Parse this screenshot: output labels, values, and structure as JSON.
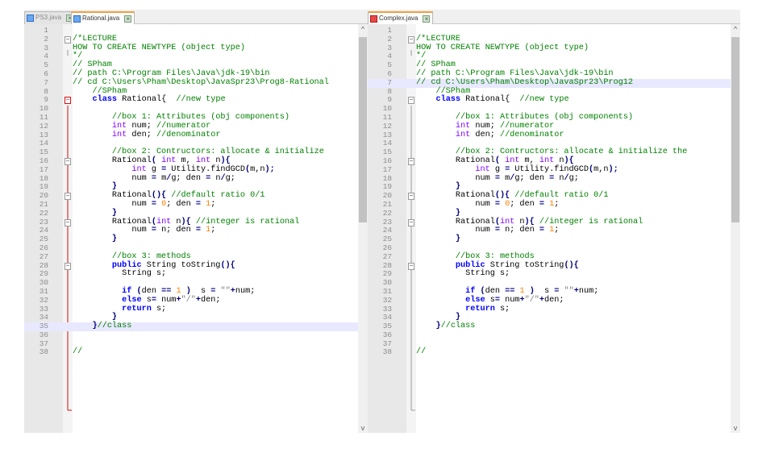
{
  "left_pane": {
    "tabs": [
      {
        "label": "PS3.java",
        "active": false
      },
      {
        "label": "Rational.java",
        "active": true
      }
    ],
    "lines": [
      [],
      [
        {
          "t": "/*LECTURE",
          "c": "cm"
        }
      ],
      [
        {
          "t": "HOW TO CREATE NEWTYPE (object type)",
          "c": "cm"
        }
      ],
      [
        {
          "t": "*/",
          "c": "cm"
        }
      ],
      [
        {
          "t": "// SPham",
          "c": "cm"
        }
      ],
      [
        {
          "t": "// path C:\\Program Files\\Java\\jdk-19\\bin",
          "c": "cm"
        }
      ],
      [
        {
          "t": "// cd C:\\Users\\Pham\\Desktop\\JavaSpr23\\Prog8-Rational",
          "c": "cm"
        }
      ],
      [
        {
          "t": "    //SPham",
          "c": "cm"
        }
      ],
      [
        {
          "t": "    "
        },
        {
          "t": "class",
          "c": "kw"
        },
        {
          "t": " Rational{  "
        },
        {
          "t": "//new type",
          "c": "cm"
        }
      ],
      [],
      [
        {
          "t": "        "
        },
        {
          "t": "//box 1: Attributes (obj components)",
          "c": "cm"
        }
      ],
      [
        {
          "t": "        "
        },
        {
          "t": "int",
          "c": "ty"
        },
        {
          "t": " num; "
        },
        {
          "t": "//numerator",
          "c": "cm"
        }
      ],
      [
        {
          "t": "        "
        },
        {
          "t": "int",
          "c": "ty"
        },
        {
          "t": " den; "
        },
        {
          "t": "//denominator",
          "c": "cm"
        }
      ],
      [],
      [
        {
          "t": "        "
        },
        {
          "t": "//box 2: Contructors: allocate & initialize",
          "c": "cm"
        }
      ],
      [
        {
          "t": "        Rational"
        },
        {
          "t": "(",
          "c": "op"
        },
        {
          "t": " "
        },
        {
          "t": "int",
          "c": "ty"
        },
        {
          "t": " m, "
        },
        {
          "t": "int",
          "c": "ty"
        },
        {
          "t": " n"
        },
        {
          "t": "){",
          "c": "op"
        }
      ],
      [
        {
          "t": "            "
        },
        {
          "t": "int",
          "c": "ty"
        },
        {
          "t": " g "
        },
        {
          "t": "=",
          "c": "op"
        },
        {
          "t": " Utility.findGCD"
        },
        {
          "t": "(",
          "c": "op"
        },
        {
          "t": "m,n"
        },
        {
          "t": ");",
          "c": "op"
        }
      ],
      [
        {
          "t": "            num "
        },
        {
          "t": "=",
          "c": "op"
        },
        {
          "t": " m"
        },
        {
          "t": "/",
          "c": "op"
        },
        {
          "t": "g; den "
        },
        {
          "t": "=",
          "c": "op"
        },
        {
          "t": " n"
        },
        {
          "t": "/",
          "c": "op"
        },
        {
          "t": "g;"
        }
      ],
      [
        {
          "t": "        "
        },
        {
          "t": "}",
          "c": "op"
        }
      ],
      [
        {
          "t": "        Rational"
        },
        {
          "t": "(){",
          "c": "op"
        },
        {
          "t": " "
        },
        {
          "t": "//default ratio 0/1",
          "c": "cm"
        }
      ],
      [
        {
          "t": "            num "
        },
        {
          "t": "=",
          "c": "op"
        },
        {
          "t": " "
        },
        {
          "t": "0",
          "c": "nm"
        },
        {
          "t": "; den "
        },
        {
          "t": "=",
          "c": "op"
        },
        {
          "t": " "
        },
        {
          "t": "1",
          "c": "nm"
        },
        {
          "t": ";"
        }
      ],
      [
        {
          "t": "        "
        },
        {
          "t": "}",
          "c": "op"
        }
      ],
      [
        {
          "t": "        Rational"
        },
        {
          "t": "(",
          "c": "op"
        },
        {
          "t": "int",
          "c": "ty"
        },
        {
          "t": " n"
        },
        {
          "t": "){",
          "c": "op"
        },
        {
          "t": " "
        },
        {
          "t": "//integer is rational",
          "c": "cm"
        }
      ],
      [
        {
          "t": "            num "
        },
        {
          "t": "=",
          "c": "op"
        },
        {
          "t": " n; den "
        },
        {
          "t": "=",
          "c": "op"
        },
        {
          "t": " "
        },
        {
          "t": "1",
          "c": "nm"
        },
        {
          "t": ";"
        }
      ],
      [
        {
          "t": "        "
        },
        {
          "t": "}",
          "c": "op"
        }
      ],
      [],
      [
        {
          "t": "        "
        },
        {
          "t": "//box 3: methods",
          "c": "cm"
        }
      ],
      [
        {
          "t": "        "
        },
        {
          "t": "public",
          "c": "kw"
        },
        {
          "t": " String toString"
        },
        {
          "t": "(){",
          "c": "op"
        }
      ],
      [
        {
          "t": "          String s;"
        }
      ],
      [],
      [
        {
          "t": "          "
        },
        {
          "t": "if",
          "c": "kw"
        },
        {
          "t": " "
        },
        {
          "t": "(",
          "c": "op"
        },
        {
          "t": "den "
        },
        {
          "t": "==",
          "c": "op"
        },
        {
          "t": " "
        },
        {
          "t": "1",
          "c": "nm"
        },
        {
          "t": " "
        },
        {
          "t": ")",
          "c": "op"
        },
        {
          "t": "  s "
        },
        {
          "t": "=",
          "c": "op"
        },
        {
          "t": " "
        },
        {
          "t": "\"\"",
          "c": "st"
        },
        {
          "t": "+",
          "c": "op"
        },
        {
          "t": "num;"
        }
      ],
      [
        {
          "t": "          "
        },
        {
          "t": "else",
          "c": "kw"
        },
        {
          "t": " s"
        },
        {
          "t": "=",
          "c": "op"
        },
        {
          "t": " num"
        },
        {
          "t": "+",
          "c": "op"
        },
        {
          "t": "\"/\"",
          "c": "st"
        },
        {
          "t": "+",
          "c": "op"
        },
        {
          "t": "den;"
        }
      ],
      [
        {
          "t": "          "
        },
        {
          "t": "return",
          "c": "kw"
        },
        {
          "t": " s;"
        }
      ],
      [
        {
          "t": "        "
        },
        {
          "t": "}",
          "c": "op"
        }
      ],
      [
        {
          "t": "    "
        },
        {
          "t": "}",
          "c": "op"
        },
        {
          "t": "//class",
          "c": "cm"
        }
      ],
      [],
      [],
      [
        {
          "t": "//",
          "c": "cm"
        }
      ]
    ]
  },
  "right_pane": {
    "tabs": [
      {
        "label": "Complex.java",
        "active": true
      }
    ],
    "lines": [
      [],
      [
        {
          "t": "/*LECTURE",
          "c": "cm"
        }
      ],
      [
        {
          "t": "HOW TO CREATE NEWTYPE (object type)",
          "c": "cm"
        }
      ],
      [
        {
          "t": "*/",
          "c": "cm"
        }
      ],
      [
        {
          "t": "// SPham",
          "c": "cm"
        }
      ],
      [
        {
          "t": "// path C:\\Program Files\\Java\\jdk-19\\bin",
          "c": "cm"
        }
      ],
      [
        {
          "t": "// cd C:\\Users\\Pham\\Desktop\\JavaSpr23\\Prog12",
          "c": "cm"
        }
      ],
      [
        {
          "t": "    //SPham",
          "c": "cm"
        }
      ],
      [
        {
          "t": "    "
        },
        {
          "t": "class",
          "c": "kw"
        },
        {
          "t": " Rational{  "
        },
        {
          "t": "//new type",
          "c": "cm"
        }
      ],
      [],
      [
        {
          "t": "        "
        },
        {
          "t": "//box 1: Attributes (obj components)",
          "c": "cm"
        }
      ],
      [
        {
          "t": "        "
        },
        {
          "t": "int",
          "c": "ty"
        },
        {
          "t": " num; "
        },
        {
          "t": "//numerator",
          "c": "cm"
        }
      ],
      [
        {
          "t": "        "
        },
        {
          "t": "int",
          "c": "ty"
        },
        {
          "t": " den; "
        },
        {
          "t": "//denominator",
          "c": "cm"
        }
      ],
      [],
      [
        {
          "t": "        "
        },
        {
          "t": "//box 2: Contructors: allocate & initialize the",
          "c": "cm"
        }
      ],
      [
        {
          "t": "        Rational"
        },
        {
          "t": "(",
          "c": "op"
        },
        {
          "t": " "
        },
        {
          "t": "int",
          "c": "ty"
        },
        {
          "t": " m, "
        },
        {
          "t": "int",
          "c": "ty"
        },
        {
          "t": " n"
        },
        {
          "t": "){",
          "c": "op"
        }
      ],
      [
        {
          "t": "            "
        },
        {
          "t": "int",
          "c": "ty"
        },
        {
          "t": " g "
        },
        {
          "t": "=",
          "c": "op"
        },
        {
          "t": " Utility.findGCD"
        },
        {
          "t": "(",
          "c": "op"
        },
        {
          "t": "m,n"
        },
        {
          "t": ");",
          "c": "op"
        }
      ],
      [
        {
          "t": "            num "
        },
        {
          "t": "=",
          "c": "op"
        },
        {
          "t": " m"
        },
        {
          "t": "/",
          "c": "op"
        },
        {
          "t": "g; den "
        },
        {
          "t": "=",
          "c": "op"
        },
        {
          "t": " n"
        },
        {
          "t": "/",
          "c": "op"
        },
        {
          "t": "g;"
        }
      ],
      [
        {
          "t": "        "
        },
        {
          "t": "}",
          "c": "op"
        }
      ],
      [
        {
          "t": "        Rational"
        },
        {
          "t": "(){",
          "c": "op"
        },
        {
          "t": " "
        },
        {
          "t": "//default ratio 0/1",
          "c": "cm"
        }
      ],
      [
        {
          "t": "            num "
        },
        {
          "t": "=",
          "c": "op"
        },
        {
          "t": " "
        },
        {
          "t": "0",
          "c": "nm"
        },
        {
          "t": "; den "
        },
        {
          "t": "=",
          "c": "op"
        },
        {
          "t": " "
        },
        {
          "t": "1",
          "c": "nm"
        },
        {
          "t": ";"
        }
      ],
      [
        {
          "t": "        "
        },
        {
          "t": "}",
          "c": "op"
        }
      ],
      [
        {
          "t": "        Rational"
        },
        {
          "t": "(",
          "c": "op"
        },
        {
          "t": "int",
          "c": "ty"
        },
        {
          "t": " n"
        },
        {
          "t": "){",
          "c": "op"
        },
        {
          "t": " "
        },
        {
          "t": "//integer is rational",
          "c": "cm"
        }
      ],
      [
        {
          "t": "            num "
        },
        {
          "t": "=",
          "c": "op"
        },
        {
          "t": " n; den "
        },
        {
          "t": "=",
          "c": "op"
        },
        {
          "t": " "
        },
        {
          "t": "1",
          "c": "nm"
        },
        {
          "t": ";"
        }
      ],
      [
        {
          "t": "        "
        },
        {
          "t": "}",
          "c": "op"
        }
      ],
      [],
      [
        {
          "t": "        "
        },
        {
          "t": "//box 3: methods",
          "c": "cm"
        }
      ],
      [
        {
          "t": "        "
        },
        {
          "t": "public",
          "c": "kw"
        },
        {
          "t": " String toString"
        },
        {
          "t": "(){",
          "c": "op"
        }
      ],
      [
        {
          "t": "          String s;"
        }
      ],
      [],
      [
        {
          "t": "          "
        },
        {
          "t": "if",
          "c": "kw"
        },
        {
          "t": " "
        },
        {
          "t": "(",
          "c": "op"
        },
        {
          "t": "den "
        },
        {
          "t": "==",
          "c": "op"
        },
        {
          "t": " "
        },
        {
          "t": "1",
          "c": "nm"
        },
        {
          "t": " "
        },
        {
          "t": ")",
          "c": "op"
        },
        {
          "t": "  s "
        },
        {
          "t": "=",
          "c": "op"
        },
        {
          "t": " "
        },
        {
          "t": "\"\"",
          "c": "st"
        },
        {
          "t": "+",
          "c": "op"
        },
        {
          "t": "num;"
        }
      ],
      [
        {
          "t": "          "
        },
        {
          "t": "else",
          "c": "kw"
        },
        {
          "t": " s"
        },
        {
          "t": "=",
          "c": "op"
        },
        {
          "t": " num"
        },
        {
          "t": "+",
          "c": "op"
        },
        {
          "t": "\"/\"",
          "c": "st"
        },
        {
          "t": "+",
          "c": "op"
        },
        {
          "t": "den;"
        }
      ],
      [
        {
          "t": "          "
        },
        {
          "t": "return",
          "c": "kw"
        },
        {
          "t": " s;"
        }
      ],
      [
        {
          "t": "        "
        },
        {
          "t": "}",
          "c": "op"
        }
      ],
      [
        {
          "t": "    "
        },
        {
          "t": "}",
          "c": "op"
        },
        {
          "t": "//class",
          "c": "cm"
        }
      ],
      [],
      [],
      [
        {
          "t": "//",
          "c": "cm"
        }
      ]
    ]
  }
}
